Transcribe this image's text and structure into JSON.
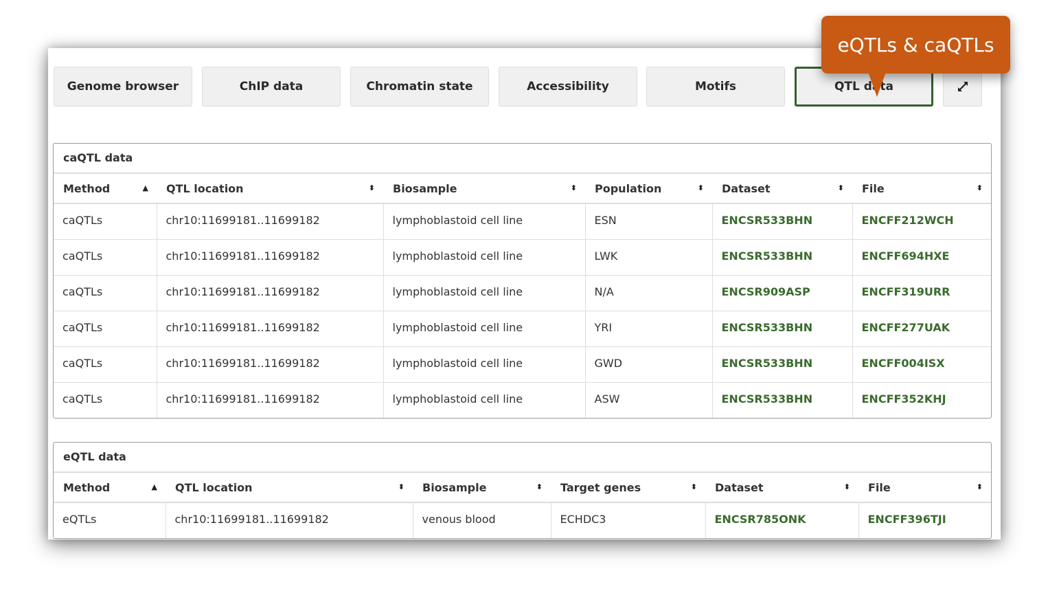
{
  "tabs": [
    {
      "label": "Genome browser",
      "active": false
    },
    {
      "label": "ChIP data",
      "active": false
    },
    {
      "label": "Chromatin state",
      "active": false
    },
    {
      "label": "Accessibility",
      "active": false
    },
    {
      "label": "Motifs",
      "active": false
    },
    {
      "label": "QTL data",
      "active": true
    }
  ],
  "expand_icon": "expand-arrows-icon",
  "tooltip": {
    "text": "eQTLs & caQTLs",
    "color": "#c85a13"
  },
  "accent_color": "#355e2d",
  "link_color": "#3a6b2e",
  "caqtl": {
    "title": "caQTL data",
    "headers": [
      "Method",
      "QTL location",
      "Biosample",
      "Population",
      "Dataset",
      "File"
    ],
    "sort_indicators": [
      "▲",
      "⬍",
      "⬍",
      "⬍",
      "⬍",
      "⬍"
    ],
    "rows": [
      [
        "caQTLs",
        "chr10:11699181..11699182",
        "lymphoblastoid cell line",
        "ESN",
        "ENCSR533BHN",
        "ENCFF212WCH"
      ],
      [
        "caQTLs",
        "chr10:11699181..11699182",
        "lymphoblastoid cell line",
        "LWK",
        "ENCSR533BHN",
        "ENCFF694HXE"
      ],
      [
        "caQTLs",
        "chr10:11699181..11699182",
        "lymphoblastoid cell line",
        "N/A",
        "ENCSR909ASP",
        "ENCFF319URR"
      ],
      [
        "caQTLs",
        "chr10:11699181..11699182",
        "lymphoblastoid cell line",
        "YRI",
        "ENCSR533BHN",
        "ENCFF277UAK"
      ],
      [
        "caQTLs",
        "chr10:11699181..11699182",
        "lymphoblastoid cell line",
        "GWD",
        "ENCSR533BHN",
        "ENCFF004ISX"
      ],
      [
        "caQTLs",
        "chr10:11699181..11699182",
        "lymphoblastoid cell line",
        "ASW",
        "ENCSR533BHN",
        "ENCFF352KHJ"
      ]
    ]
  },
  "eqtl": {
    "title": "eQTL data",
    "headers": [
      "Method",
      "QTL location",
      "Biosample",
      "Target genes",
      "Dataset",
      "File"
    ],
    "sort_indicators": [
      "▲",
      "⬍",
      "⬍",
      "⬍",
      "⬍",
      "⬍"
    ],
    "rows": [
      [
        "eQTLs",
        "chr10:11699181..11699182",
        "venous blood",
        "ECHDC3",
        "ENCSR785ONK",
        "ENCFF396TJI"
      ]
    ]
  }
}
